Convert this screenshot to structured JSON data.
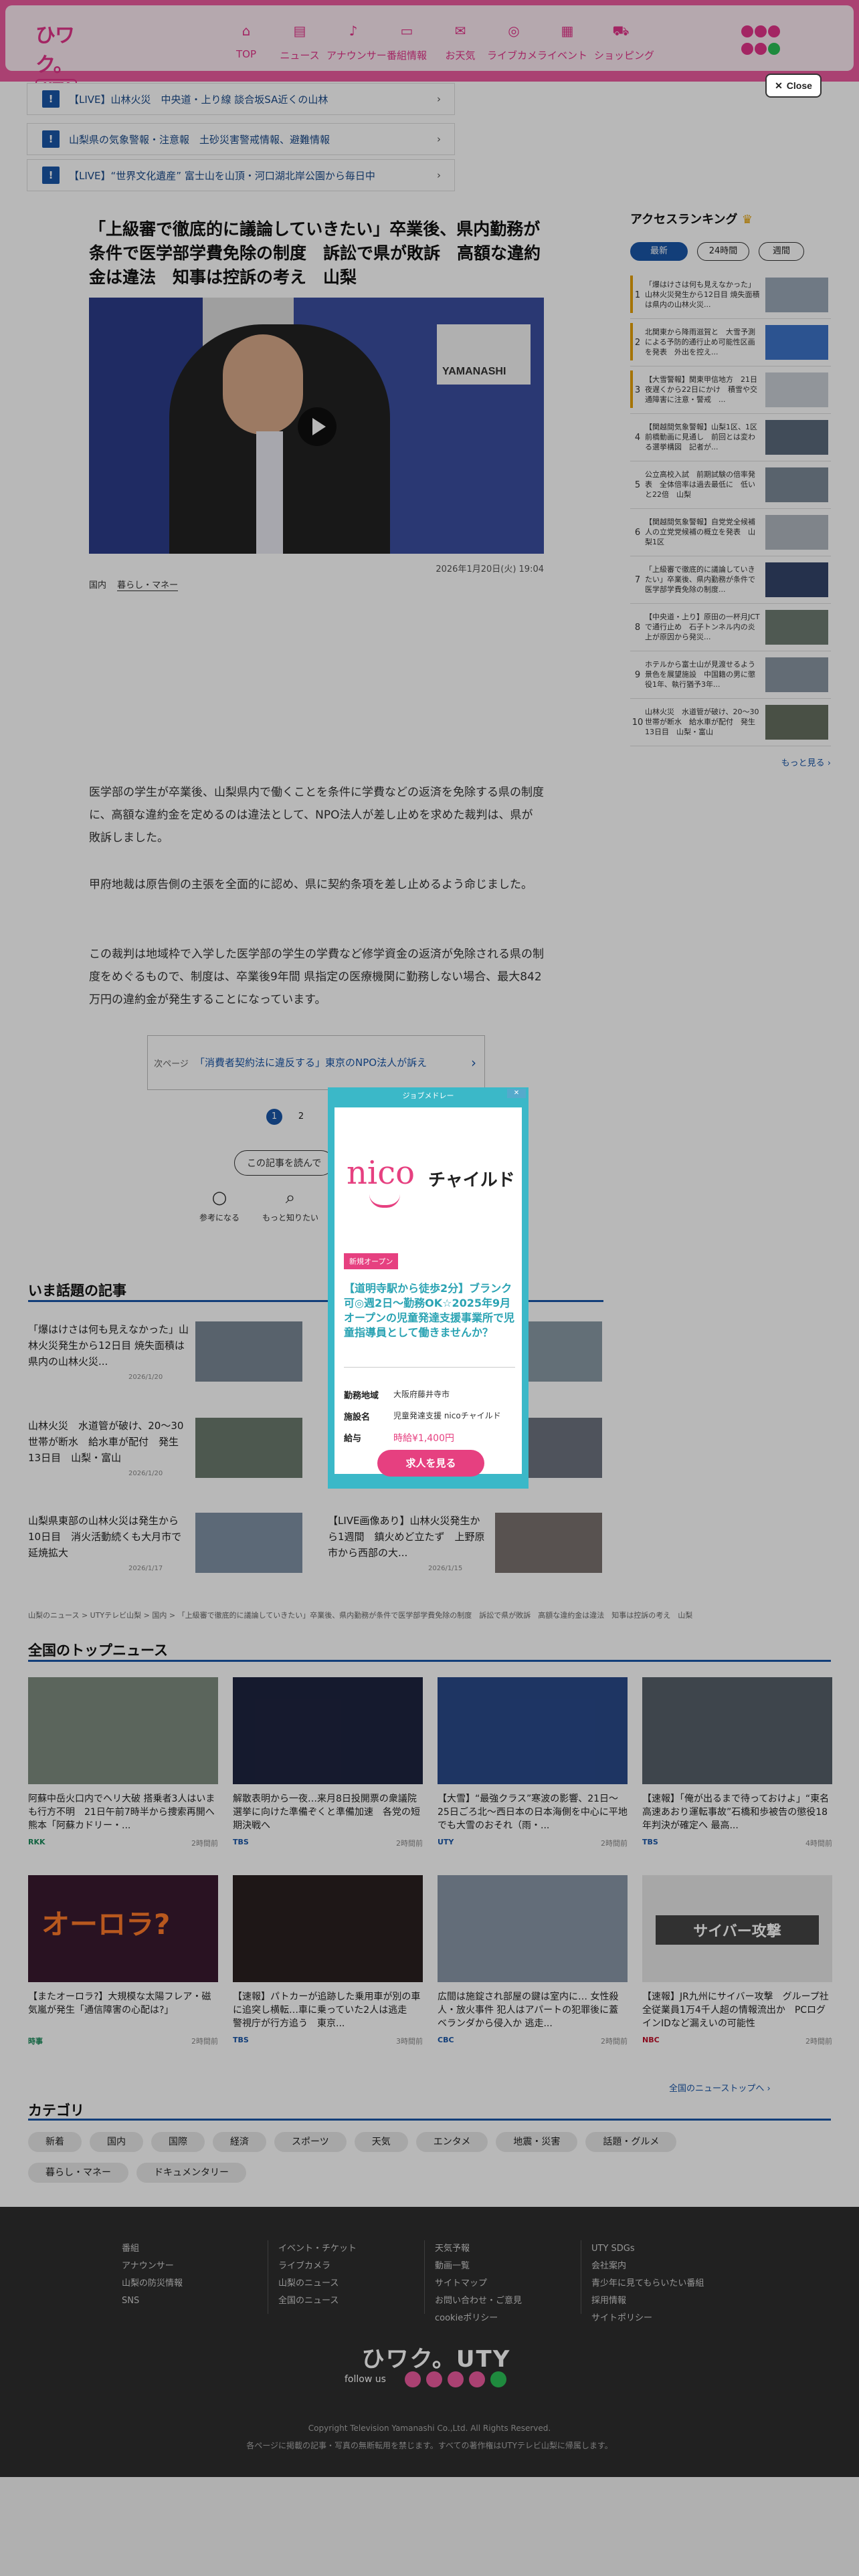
{
  "header": {
    "logo_top": "ひワク。",
    "logo_bottom": "UTY",
    "nav": [
      {
        "icon": "home-icon",
        "glyph": "⌂",
        "label": "TOP"
      },
      {
        "icon": "news-icon",
        "glyph": "▤",
        "label": "ニュース"
      },
      {
        "icon": "mic-icon",
        "glyph": "♪",
        "label": "アナウンサー"
      },
      {
        "icon": "tv-icon",
        "glyph": "▭",
        "label": "番組情報"
      },
      {
        "icon": "gift-icon",
        "glyph": "✉",
        "label": "お天気"
      },
      {
        "icon": "camera-icon",
        "glyph": "◎",
        "label": "ライブカメラ"
      },
      {
        "icon": "calendar-icon",
        "glyph": "▦",
        "label": "イベント"
      },
      {
        "icon": "cart-icon",
        "glyph": "⛟",
        "label": "ショッピング"
      }
    ],
    "close_label": "Close"
  },
  "alerts": [
    {
      "text": "【LIVE】山林火災　中央道・上り線 談合坂SA近くの山林",
      "chevron": "›"
    },
    {
      "text": "山梨県の気象警報・注意報　土砂災害警戒情報、避難情報",
      "chevron": "›"
    },
    {
      "text": "【LIVE】“世界文化遺産” 富士山を山頂・河口湖北岸公園から毎日中",
      "chevron": "›"
    }
  ],
  "article": {
    "title": "「上級審で徹底的に議論していきたい」卒業後、県内勤務が条件で医学部学費免除の制度　訴訟で県が敗訴　高額な違約金は違法　知事は控訴の考え　山梨",
    "sign_text": "YAMANASHI",
    "date": "2026年1月20日(火) 19:04",
    "category": "国内",
    "category_link": "暮らし・マネー",
    "paragraphs": [
      "医学部の学生が卒業後、山梨県内で働くことを条件に学費などの返済を免除する県の制度に、高額な違約金を定めるのは違法として、NPO法人が差し止めを求めた裁判は、県が敗訴しました。",
      "甲府地裁は原告側の主張を全面的に認め、県に契約条項を差し止めるよう命じました。",
      "この裁判は地域枠で入学した医学部の学生の学費など修学資金の返済が免除される県の制度をめぐるもので、制度は、卒業後9年間 県指定の医療機関に勤務しない場合、最大842万円の違約金が発生することになっています。"
    ],
    "prev_label": "次ページ",
    "prev_title": "「消費者契約法に違反する」東京のNPO法人が訴え",
    "prev_chevron": "›",
    "pages": [
      "1",
      "2"
    ],
    "feedback_prompt": "この記事を読んで",
    "reactions": [
      {
        "icon": "bulb-icon",
        "glyph": "💡",
        "label": "参考になる"
      },
      {
        "icon": "magnifier-icon",
        "glyph": "🔍",
        "label": "もっと知りたい"
      }
    ]
  },
  "ranking": {
    "title": "アクセスランキング",
    "tabs": [
      "最新",
      "24時間",
      "週間"
    ],
    "items": [
      {
        "num": "1",
        "text": "「爆はけさは何も見えなかった」山林火災発生から12日目 焼失面積は県内の山林火災..."
      },
      {
        "num": "2",
        "text": "北関東から降雨滋賀と　大雪予測による予防的通行止め可能性区画を発表　外出を控え..."
      },
      {
        "num": "3",
        "text": "【大雪警報】関東甲信地方　21日夜遅くから22日にかけ　積雪や交通障害に注意・警戒　..."
      },
      {
        "num": "4",
        "text": "【関越間気象警報】山梨1区、1区　前橋動画に見通し　前回とは変わる選挙構図　記者が..."
      },
      {
        "num": "5",
        "text": "公立高校入試　前期試験の倍率発表　全体倍率は過去最低に　低いと22倍　山梨"
      },
      {
        "num": "6",
        "text": "【関越間気象警報】自党党全候補人の立党党候補の概立を発表　山梨1区"
      },
      {
        "num": "7",
        "text": "「上級審で徹底的に議論していきたい」卒業後、県内勤務が条件で医学部学費免除の制度..."
      },
      {
        "num": "8",
        "text": "【中央道・上り】原田の一杯月JCT で通行止め　石子トンネル内の炎上が原因から発災..."
      },
      {
        "num": "9",
        "text": "ホテルから富士山が見渡せるよう景色を展望施設　中国籍の男に懲役1年、執行猶予3年..."
      },
      {
        "num": "10",
        "text": "山林火災　水道管が破け、20～30世帯が断水　給水車が配付　発生13日目　山梨・富山"
      }
    ],
    "more": "もっと見る ›"
  },
  "topics": {
    "title": "いま話題の記事",
    "items": [
      {
        "text": "「爆はけさは何も見えなかった」山林火災発生から12日目 焼失面積は県内の山林火災...",
        "date": "2026/1/20"
      },
      {
        "text": "山林火災　水道管が破け、20～30世帯が断水　給水車が配付　発生13日目　山梨・富山",
        "date": "2026/1/20"
      },
      {
        "text": "山梨県東部の山林火災は発生から10日目　消火活動続くも大月市で延焼拡大",
        "date": "2026/1/17"
      },
      {
        "text": "【LIVE画像あり】山林火災発生から1週間　鎮火めど立たず　上野原市から西部の大...",
        "date": "2026/1/15"
      }
    ],
    "breadcrumb": "山梨のニュース > UTYテレビ山梨 > 国内 > 「上級審で徹底的に議論していきたい」卒業後、県内勤務が条件で医学部学費免除の制度　訴訟で県が敗訴　高額な違約金は違法　知事は控訴の考え　山梨"
  },
  "national": {
    "title": "全国のトップニュース",
    "items": [
      {
        "text": "阿蘇中岳火口内でヘリ大破 搭乗者3人はいまも行方不明　21日午前7時半から捜索再開へ　熊本「阿蘇カドリー・...",
        "src": "RKK",
        "time": "2時間前"
      },
      {
        "text": "解散表明から一夜…来月8日投開票の衆議院選挙に向けた準備ぞくと準備加速　各党の短期決戦へ",
        "src": "TBS",
        "time": "2時間前"
      },
      {
        "text": "【大雪】“最強クラス”寒波の影響、21日～25日ごろ北～西日本の日本海側を中心に平地でも大雪のおそれ（雨・...",
        "src": "UTY",
        "time": "2時間前"
      },
      {
        "text": "【速報】「俺が出るまで待っておけよ」“東名高速あおり運転事故”石橋和歩被告の懲役18年判決が確定へ 最高...",
        "src": "TBS",
        "time": "4時間前"
      },
      {
        "text": "【またオーロラ?】大規模な太陽フレア・磁気嵐が発生「通信障害の心配は?」",
        "src": "時事",
        "time": "2時間前"
      },
      {
        "text": "【速報】パトカーが追跡した乗用車が別の車に追突し横転…車に乗っていた2人は逃走　警視庁が行方追う　東京...",
        "src": "TBS",
        "time": "3時間前"
      },
      {
        "text": "広間は施錠され部屋の鍵は室内に… 女性殺人・放火事件 犯人はアパートの犯罪後に蓋ベランダから侵入か 逃走...",
        "src": "CBC",
        "time": "2時間前"
      },
      {
        "text": "【速報】JR九州にサイバー攻撃　グループ社全従業員1万4千人超の情報流出か　PCログインIDなど漏えいの可能性",
        "src": "NBC",
        "time": "2時間前"
      }
    ],
    "ad_text": "オーロラ?",
    "cyber_text": "サイバー攻撃",
    "more": "全国のニューストップへ ›"
  },
  "categories": {
    "title": "カテゴリ",
    "row1": [
      "新着",
      "国内",
      "国際",
      "経済",
      "スポーツ",
      "天気",
      "エンタメ",
      "地震・災害",
      "話題・グルメ"
    ],
    "row2": [
      "暮らし・マネー",
      "ドキュメンタリー"
    ]
  },
  "footer": {
    "col1": [
      "番組",
      "アナウンサー",
      "山梨の防災情報",
      "SNS"
    ],
    "col2": [
      "イベント・チケット",
      "ライブカメラ",
      "山梨のニュース",
      "全国のニュース"
    ],
    "col3": [
      "天気予報",
      "動画一覧",
      "サイトマップ",
      "お問い合わせ・ご意見",
      "cookieポリシー"
    ],
    "col4": [
      "UTY SDGs",
      "会社案内",
      "青少年に見てもらいたい番組",
      "採用情報",
      "サイトポリシー"
    ],
    "logo": "ひワク。UTY",
    "follow": "follow us",
    "copyright": "Copyright Television Yamanashi Co.,Ltd. All Rights Reserved.",
    "notice": "各ページに掲載の記事・写真の無断転用を禁じます。すべての著作権はUTYテレビ山梨に帰属します。"
  },
  "ad": {
    "top": "ジョブメドレー",
    "x": "✕",
    "brand": "nico",
    "brand2": "チャイルド",
    "badge": "新規オープン",
    "headline": "【道明寺駅から徒歩2分】ブランク可◎週2日〜勤務OK☆2025年9月オープンの児童発達支援事業所で児童指導員として働きませんか？",
    "rows": [
      {
        "k": "勤務地域",
        "v": "大阪府藤井寺市"
      },
      {
        "k": "施設名",
        "v": "児童発達支援 nicoチャイルド"
      },
      {
        "k": "給与",
        "v": "時給¥1,400円"
      }
    ],
    "cta": "求人を見る"
  }
}
